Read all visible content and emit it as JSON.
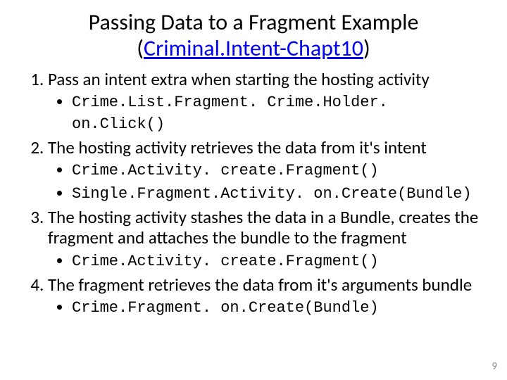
{
  "title": {
    "line1": "Passing Data to a Fragment Example",
    "paren_open": "(",
    "link_text": "Criminal.Intent-Chapt10",
    "paren_close": ")"
  },
  "items": [
    {
      "text": "Pass an intent extra when starting the hosting activity",
      "subs": [
        {
          "code": "Crime.List.Fragment. Crime.Holder. on.Click()"
        }
      ]
    },
    {
      "text": "The hosting activity retrieves the data from it's intent",
      "subs": [
        {
          "code": "Crime.Activity. create.Fragment()"
        },
        {
          "code": "Single.Fragment.Activity. on.Create(Bundle)"
        }
      ]
    },
    {
      "text": "The hosting activity stashes the data in a Bundle, creates the fragment and attaches the bundle to the fragment",
      "subs": [
        {
          "code": "Crime.Activity. create.Fragment()"
        }
      ]
    },
    {
      "text": "The fragment retrieves the data from it's arguments bundle",
      "subs": [
        {
          "code": "Crime.Fragment. on.Create(Bundle)"
        }
      ]
    }
  ],
  "page_number": "9"
}
